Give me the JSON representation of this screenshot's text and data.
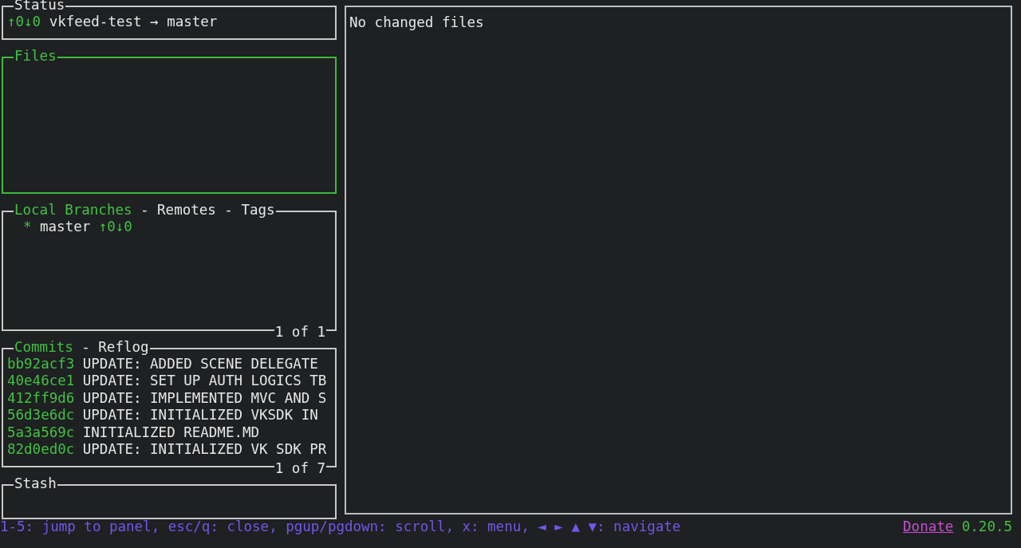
{
  "status": {
    "title": "Status",
    "ahead_behind": "↑0↓0",
    "repo": "vkfeed-test → master",
    "active": false
  },
  "files": {
    "title": "Files",
    "active": true
  },
  "branches": {
    "active": false,
    "separator": "-",
    "tabs": [
      {
        "label": "Local Branches",
        "selected": true
      },
      {
        "label": "Remotes",
        "selected": false
      },
      {
        "label": "Tags",
        "selected": false
      }
    ],
    "items": [
      {
        "marker": "*",
        "name": "master",
        "ahead_behind": "↑0↓0"
      }
    ],
    "counter": "1 of 1"
  },
  "commits": {
    "active": false,
    "separator": "-",
    "tabs": [
      {
        "label": "Commits",
        "selected": true
      },
      {
        "label": "Reflog",
        "selected": false
      }
    ],
    "rows": [
      {
        "hash": "bb92acf3",
        "message": "UPDATE: ADDED SCENE DELEGATE"
      },
      {
        "hash": "40e46ce1",
        "message": "UPDATE: SET UP AUTH LOGICS TB"
      },
      {
        "hash": "412ff9d6",
        "message": "UPDATE: IMPLEMENTED MVC AND S"
      },
      {
        "hash": "56d3e6dc",
        "message": "UPDATE: INITIALIZED VKSDK IN"
      },
      {
        "hash": "5a3a569c",
        "message": "INITIALIZED README.MD"
      },
      {
        "hash": "82d0ed0c",
        "message": "UPDATE: INITIALIZED VK SDK PR"
      }
    ],
    "counter": "1 of 7"
  },
  "stash": {
    "title": "Stash",
    "active": false
  },
  "main": {
    "text": "No changed files"
  },
  "footer": {
    "keybindings": "1-5: jump to panel, esc/q: close, pgup/pgdown: scroll, x: menu, ◄ ► ▲ ▼: navigate",
    "donate": "Donate",
    "version": "0.20.5"
  }
}
